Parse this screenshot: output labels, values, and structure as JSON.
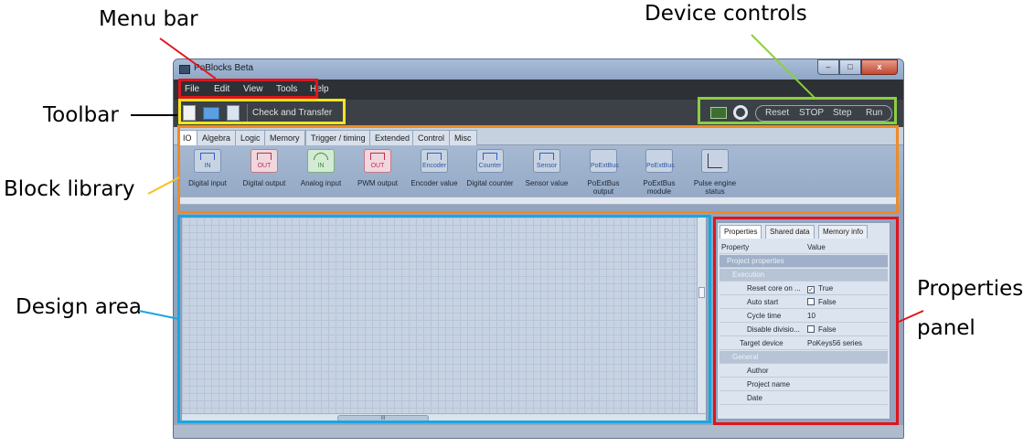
{
  "callouts": {
    "menu_bar": "Menu bar",
    "device_controls": "Device controls",
    "toolbar": "Toolbar",
    "block_library": "Block library",
    "design_area": "Design area",
    "properties_1": "Properties",
    "properties_2": "panel"
  },
  "window": {
    "title": "PoBlocks Beta",
    "minimize": "–",
    "maximize": "□",
    "close": "x"
  },
  "menu": [
    "File",
    "Edit",
    "View",
    "Tools",
    "Help"
  ],
  "toolbar": {
    "check_transfer": "Check and Transfer",
    "device_buttons": [
      "Reset",
      "STOP",
      "Step",
      "Run"
    ]
  },
  "library": {
    "tabs": [
      "IO",
      "Algebra",
      "Logic",
      "Memory",
      "Trigger / timing",
      "Extended",
      "Control",
      "Misc"
    ],
    "blocks": [
      {
        "label": "Digital input",
        "icon_text": "IN",
        "style": "blue"
      },
      {
        "label": "Digital output",
        "icon_text": "OUT",
        "style": "red"
      },
      {
        "label": "Analog input",
        "icon_text": "IN",
        "style": "green"
      },
      {
        "label": "PWM output",
        "icon_text": "OUT",
        "style": "red"
      },
      {
        "label": "Encoder value",
        "icon_text": "Encoder",
        "style": "plain"
      },
      {
        "label": "Digital counter",
        "icon_text": "Counter",
        "style": "plain"
      },
      {
        "label": "Sensor value",
        "icon_text": "Sensor",
        "style": "plain"
      },
      {
        "label": "PoExtBus output",
        "icon_text": "PoExtBus",
        "style": "plain"
      },
      {
        "label": "PoExtBus module",
        "icon_text": "PoExtBus",
        "style": "plain"
      },
      {
        "label": "Pulse engine status",
        "icon_text": "",
        "style": "plain"
      }
    ]
  },
  "design": {
    "hscroll_grip": "III"
  },
  "properties": {
    "tabs": [
      "Properties",
      "Shared data",
      "Memory info"
    ],
    "header": {
      "property": "Property",
      "value": "Value"
    },
    "rows": [
      {
        "kind": "section",
        "key": "Project properties",
        "value": ""
      },
      {
        "kind": "sub",
        "key": "Execution",
        "value": ""
      },
      {
        "kind": "item",
        "key": "Reset core on ...",
        "value": "True",
        "checked": true
      },
      {
        "kind": "item",
        "key": "Auto start",
        "value": "False",
        "checked": false
      },
      {
        "kind": "item",
        "key": "Cycle time",
        "value": "10"
      },
      {
        "kind": "item",
        "key": "Disable divisio...",
        "value": "False",
        "checked": false
      },
      {
        "kind": "item2",
        "key": "Target device",
        "value": "PoKeys56 series"
      },
      {
        "kind": "sub",
        "key": "General",
        "value": ""
      },
      {
        "kind": "item",
        "key": "Author",
        "value": ""
      },
      {
        "kind": "item",
        "key": "Project name",
        "value": ""
      },
      {
        "kind": "item",
        "key": "Date",
        "value": ""
      }
    ]
  },
  "colors": {
    "menu_highlight": "#e0141c",
    "toolbar_highlight": "#f5e61a",
    "device_highlight": "#8ccf3f",
    "library_highlight": "#f08a24",
    "design_highlight": "#1aa6e0",
    "properties_highlight": "#e0141c"
  }
}
